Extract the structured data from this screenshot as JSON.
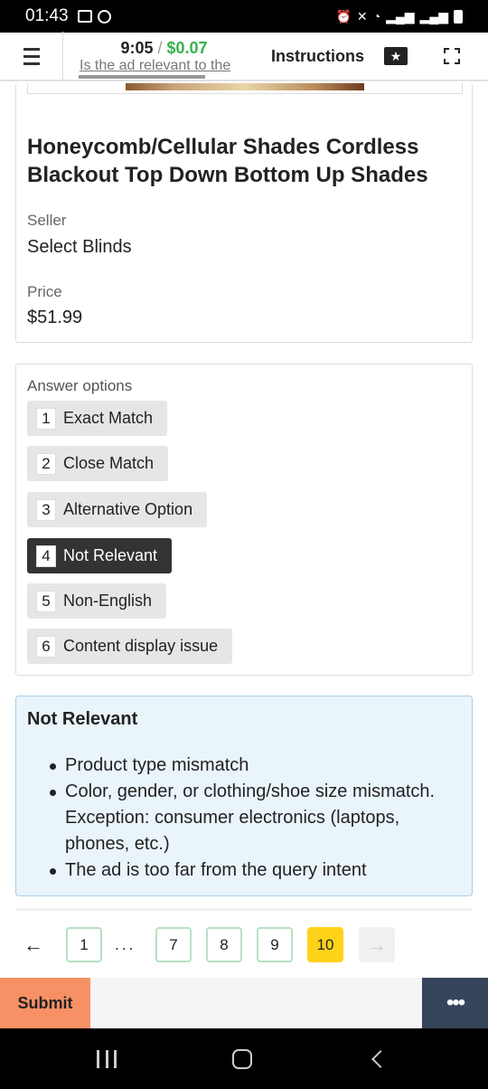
{
  "status_bar": {
    "time": "01:43",
    "left_icons": [
      "gallery-icon",
      "whatsapp-icon"
    ],
    "right_icons": [
      "alarm-icon",
      "mute-icon",
      "wifi-icon",
      "signal-icon",
      "signal-icon",
      "battery-icon"
    ]
  },
  "task_header": {
    "timer": "9:05",
    "separator": "/",
    "reward": "$0.07",
    "question": "Is the ad relevant to the",
    "instructions_label": "Instructions",
    "icons": [
      "menu-icon",
      "star-icon",
      "fullscreen-icon"
    ]
  },
  "product": {
    "title": "Honeycomb/Cellular Shades Cordless Blackout Top Down Bottom Up Shades",
    "seller_label": "Seller",
    "seller_value": "Select Blinds",
    "price_label": "Price",
    "price_value": "$51.99"
  },
  "answers": {
    "label": "Answer options",
    "options": [
      {
        "num": "1",
        "label": "Exact Match"
      },
      {
        "num": "2",
        "label": "Close Match"
      },
      {
        "num": "3",
        "label": "Alternative Option"
      },
      {
        "num": "4",
        "label": "Not Relevant"
      },
      {
        "num": "5",
        "label": "Non-English"
      },
      {
        "num": "6",
        "label": "Content display issue"
      }
    ],
    "selected": "4"
  },
  "info": {
    "title": "Not Relevant",
    "bullets": [
      "Product type mismatch",
      "Color, gender, or clothing/shoe size mismatch. Exception: consumer electronics (laptops, phones, etc.)",
      "The ad is too far from the query intent"
    ]
  },
  "pagination": {
    "prev": "←",
    "next": "→",
    "ellipsis": "...",
    "pages": [
      "1",
      "7",
      "8",
      "9",
      "10"
    ],
    "current": "10"
  },
  "actions": {
    "submit_label": "Submit",
    "more_label": "•••"
  },
  "colors": {
    "reward": "#35b34a",
    "submit_bg": "#f79065",
    "current_page": "#ffd21a",
    "more_bg": "#36455a",
    "info_bg": "#eaf4fb",
    "selected_option": "#333333"
  }
}
